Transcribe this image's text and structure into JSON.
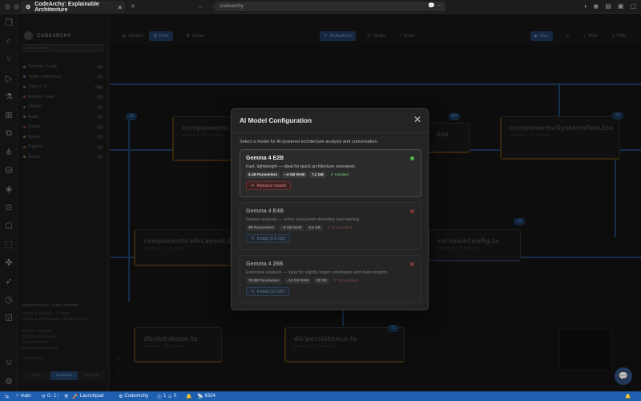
{
  "window": {
    "tab_title": "CodeArchy: Explainable Architecture",
    "url": "codearchy"
  },
  "app": {
    "brand": "CODEARCHY",
    "search_placeholder": "Search files...",
    "categories": [
      {
        "label": "Services / Logic",
        "count": "2",
        "color": "#4a7a4a"
      },
      {
        "label": "Types / Interfaces",
        "count": "2",
        "color": "#4a6a8a"
      },
      {
        "label": "Views / UI",
        "count": "10",
        "color": "#7a5a3a"
      },
      {
        "label": "Models / Data",
        "count": "3",
        "color": "#7a3a5a"
      },
      {
        "label": "Utilities",
        "count": "4",
        "color": "#3a5a7a"
      },
      {
        "label": "Audio",
        "count": "1",
        "color": "#4a6a4a"
      },
      {
        "label": "Parser",
        "count": "1",
        "color": "#7a3a3a"
      },
      {
        "label": "Syncer",
        "count": "1",
        "color": "#6a6a3a"
      },
      {
        "label": "Pipeline",
        "count": "1",
        "color": "#7a4a2a"
      },
      {
        "label": "Scripts",
        "count": "1",
        "color": "#5a7a3a"
      }
    ],
    "footer": {
      "header": "NARRATIONS / EXPLAINERS",
      "line1": "Ask for a question — a visual",
      "line2": "narration of the answer will appear here.",
      "stats": [
        "44 Files analyzed",
        "1003 symbols found",
        "85 relationships",
        "Explainers generated"
      ],
      "ai_label": "AI Narrations"
    },
    "segments": [
      "Fast",
      "Moderate",
      "In-depth"
    ],
    "active_segment": "Moderate"
  },
  "toolbar": {
    "system": "System",
    "flow": "Flow",
    "gener": "Gener",
    "ai_analysis": "AI Analysis",
    "model": "Model",
    "voice": "Voice",
    "run": "Run",
    "svg": "SVG",
    "png": "PNG"
  },
  "canvas": {
    "nodes": [
      {
        "title": "components/...",
        "sub": "typescript · 84 symbols"
      },
      {
        "title": ".tsx",
        "sub": ""
      },
      {
        "title": "components/SystemView.tsx",
        "sub": "typescript · 73 symbols"
      },
      {
        "title": "components/elkLayout.ts",
        "sub": "typescript · 31 symbols"
      },
      {
        "title": "ce/voiceConfig.ts",
        "sub": "typescript · 39 symbols"
      },
      {
        "title": "db/database.ts",
        "sub": "typescript · 35 symbols"
      },
      {
        "title": "db/persistence.ts",
        "sub": "typescript · 72 symbols"
      }
    ],
    "badges": [
      "18",
      "100",
      "73",
      "18",
      "71"
    ]
  },
  "modal": {
    "title": "AI Model Configuration",
    "description": "Select a model for AI-powered architecture analysis and conversation.",
    "models": [
      {
        "name": "Gemma 4 E2B",
        "description": "Fast, lightweight — ideal for quick architecture overviews.",
        "params": "5.1B Parameters",
        "ram": "~4 GB RAM",
        "size": "7.2 GB",
        "status": "Installed",
        "status_color": "#4fb84f",
        "action": "Remove model"
      },
      {
        "name": "Gemma 4 E4B",
        "description": "Deeper analysis — richer subsystem detection and naming.",
        "params": "8B Parameters",
        "ram": "~8 GB RAM",
        "size": "9.6 GB",
        "status": "Not installed",
        "status_color": "#c24a4a",
        "action": "Install (9.6 GB)"
      },
      {
        "name": "Gemma 4 26B",
        "description": "Extensive analysis — ideal for slightly larger codebases and deep insights.",
        "params": "25.8B Parameters",
        "ram": "~16 GB RAM",
        "size": "18 GB",
        "status": "Not installed",
        "status_color": "#c24a4a",
        "action": "Install (18 GB)"
      }
    ]
  },
  "statusbar": {
    "branch": "main",
    "sync": "0↓ 1↑",
    "launchpad": "Launchpad",
    "app": "CodeArchy",
    "errors": "1",
    "warnings": "0",
    "port": "6324"
  },
  "colors": {
    "accent": "#1f5fb0",
    "installed": "#4fb84f",
    "not_installed": "#c24a4a"
  }
}
